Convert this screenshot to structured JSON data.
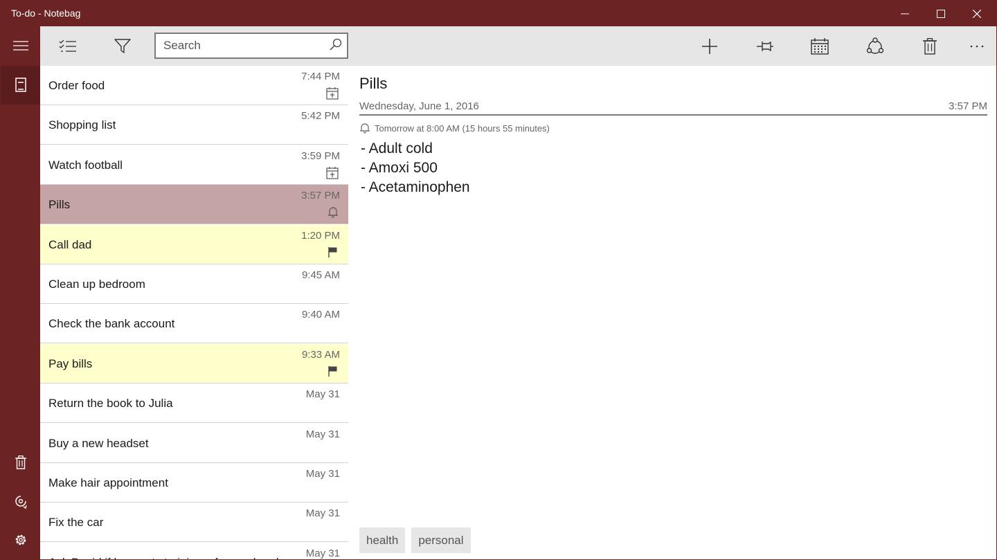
{
  "window": {
    "title": "To-do - Notebag"
  },
  "search": {
    "placeholder": "Search"
  },
  "notes": [
    {
      "title": "Order food",
      "time": "7:44 PM",
      "icon": "calendar-icon",
      "state": "normal"
    },
    {
      "title": "Shopping list",
      "time": "5:42 PM",
      "icon": "",
      "state": "normal"
    },
    {
      "title": "Watch football",
      "time": "3:59 PM",
      "icon": "calendar-icon",
      "state": "normal"
    },
    {
      "title": "Pills",
      "time": "3:57 PM",
      "icon": "bell-icon",
      "state": "selected"
    },
    {
      "title": "Call dad",
      "time": "1:20 PM",
      "icon": "flag-icon",
      "state": "flagged"
    },
    {
      "title": "Clean up bedroom",
      "time": "9:45 AM",
      "icon": "",
      "state": "normal"
    },
    {
      "title": "Check the bank account",
      "time": "9:40 AM",
      "icon": "",
      "state": "normal"
    },
    {
      "title": "Pay bills",
      "time": "9:33 AM",
      "icon": "flag-icon",
      "state": "flagged"
    },
    {
      "title": "Return the book to Julia",
      "time": "May 31",
      "icon": "",
      "state": "normal"
    },
    {
      "title": "Buy a new headset",
      "time": "May 31",
      "icon": "",
      "state": "normal"
    },
    {
      "title": "Make hair appointment",
      "time": "May 31",
      "icon": "",
      "state": "normal"
    },
    {
      "title": "Fix the car",
      "time": "May 31",
      "icon": "",
      "state": "normal"
    },
    {
      "title": "Ask David if he wants to join us for weekend",
      "time": "May 31",
      "icon": "",
      "state": "normal"
    }
  ],
  "detail": {
    "title": "Pills",
    "date": "Wednesday, June 1, 2016",
    "time": "3:57 PM",
    "reminder": "Tomorrow at 8:00 AM (15 hours 55 minutes)",
    "lines": [
      "- Adult cold",
      "- Amoxi 500",
      "- Acetaminophen"
    ],
    "tags": [
      "health",
      "personal"
    ]
  },
  "colors": {
    "accent": "#6b2324",
    "selected_row": "#c4a4a5",
    "flagged_row": "#ffffcc",
    "toolbar": "#e6e6e6"
  }
}
